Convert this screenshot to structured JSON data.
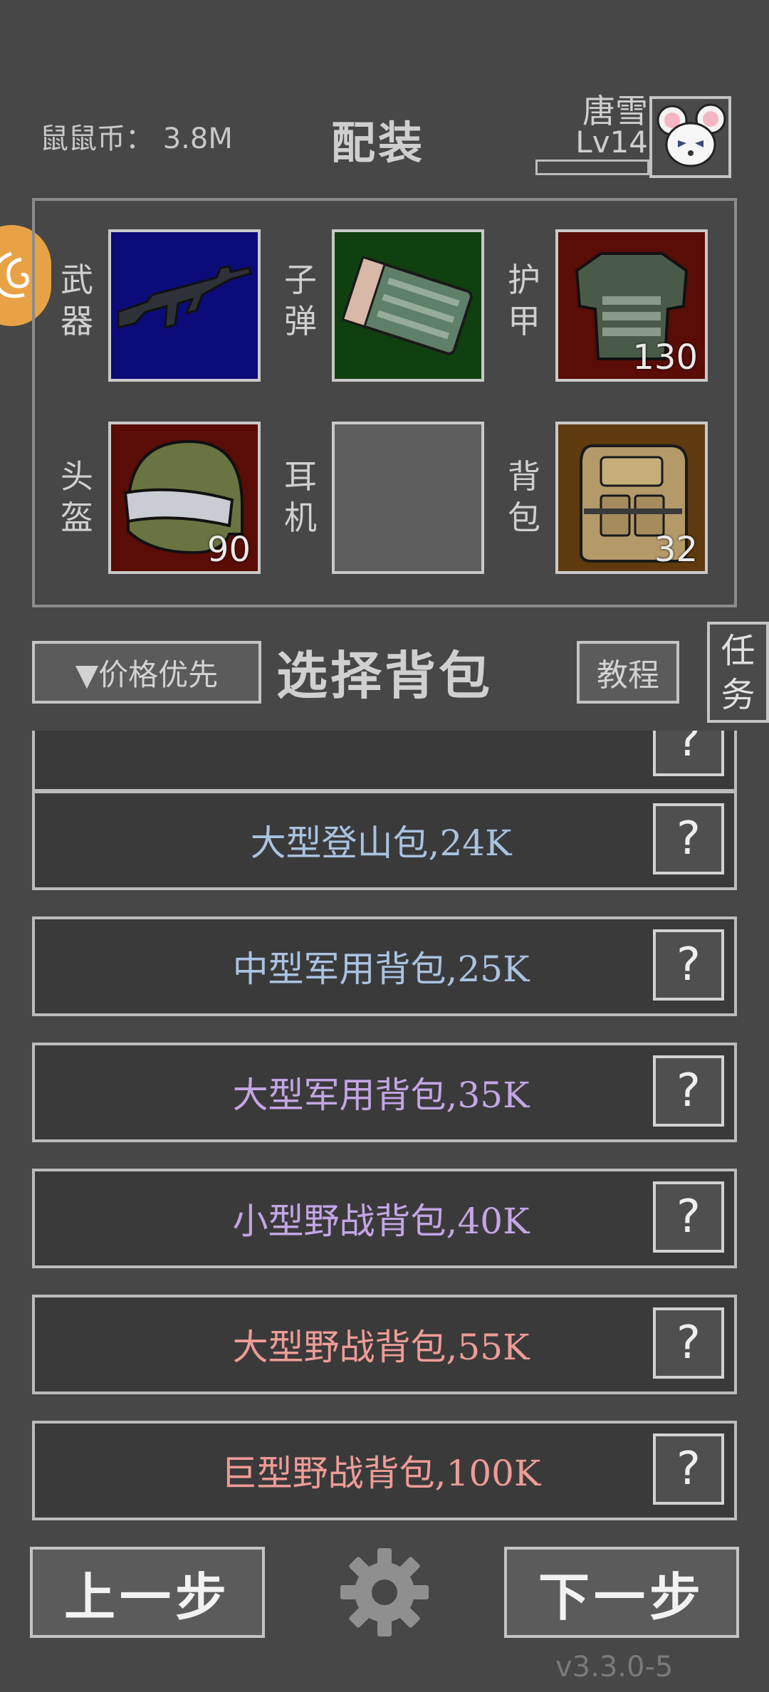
{
  "header": {
    "coins": "鼠鼠币： 3.8M",
    "title": "配装",
    "player_name": "唐雪",
    "player_level": "Lv14"
  },
  "equipment": {
    "weapon": {
      "label": "武器",
      "count": "",
      "icon": "rifle-icon",
      "bg": "#0b0b7a"
    },
    "ammo": {
      "label": "子弹",
      "count": "",
      "icon": "ammo-box-icon",
      "bg": "#10400f"
    },
    "armor": {
      "label": "护甲",
      "count": "130",
      "icon": "body-armor-icon",
      "bg": "#5a0c06"
    },
    "helmet": {
      "label": "头盔",
      "count": "90",
      "icon": "helmet-icon",
      "bg": "#5a0c06"
    },
    "headset": {
      "label": "耳机",
      "count": "",
      "icon": "empty-slot",
      "bg": "#5e5e5e"
    },
    "backpack": {
      "label": "背包",
      "count": "32",
      "icon": "backpack-icon",
      "bg": "#5e3a0e"
    }
  },
  "toolbar": {
    "sort_label": "▼价格优先",
    "section_title": "选择背包",
    "tutorial_label": "教程",
    "task_label": "任务"
  },
  "backpack_list": [
    {
      "name": "",
      "color": "#a9c3e0",
      "info": "?"
    },
    {
      "name": "大型登山包,24K",
      "color": "#a9c3e0",
      "info": "?"
    },
    {
      "name": "中型军用背包,25K",
      "color": "#a9c3e0",
      "info": "?"
    },
    {
      "name": "大型军用背包,35K",
      "color": "#c3a6e4",
      "info": "?"
    },
    {
      "name": "小型野战背包,40K",
      "color": "#c3a6e4",
      "info": "?"
    },
    {
      "name": "大型野战背包,55K",
      "color": "#ee9c96",
      "info": "?"
    },
    {
      "name": "巨型野战背包,100K",
      "color": "#ee9c96",
      "info": "?"
    }
  ],
  "footer": {
    "prev_label": "上一步",
    "next_label": "下一步",
    "version": "v3.3.0-5"
  },
  "colors": {
    "background": "#474747",
    "quest_orb": "#e8a246",
    "border": "#c4c4c4"
  }
}
